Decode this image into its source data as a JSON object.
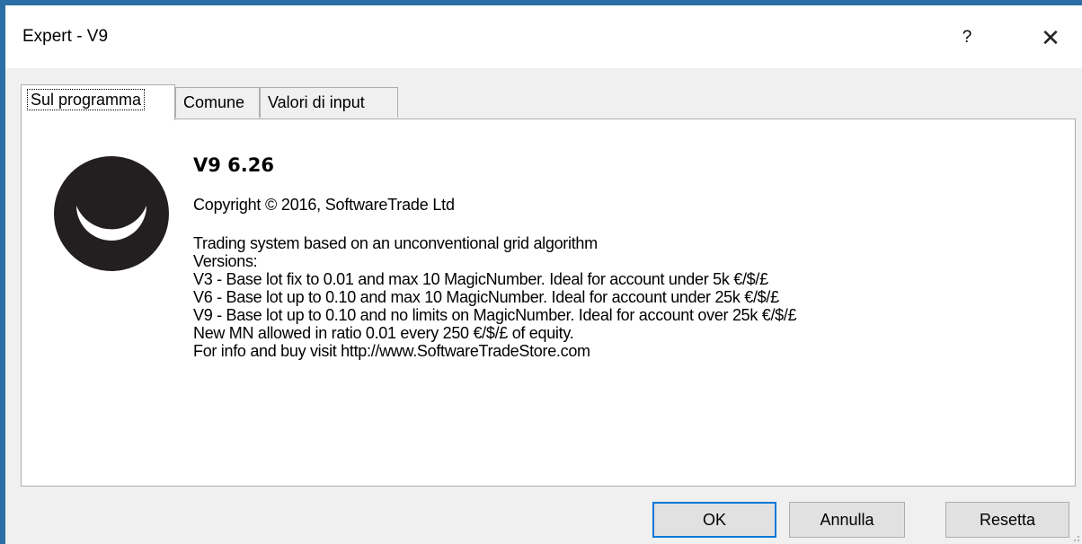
{
  "window": {
    "title": "Expert - V9",
    "help_label": "?",
    "close_label": "✕"
  },
  "tabs": [
    {
      "label": "Sul programma",
      "active": true
    },
    {
      "label": "Comune",
      "active": false
    },
    {
      "label": "Valori di input",
      "active": false
    }
  ],
  "about": {
    "logo_icon": "crescent-circle-logo-icon",
    "title": "V9 6.26",
    "copyright_symbol": "©",
    "copyright_text": "Copyright © 2016, SoftwareTrade Ltd",
    "description_lines": [
      "Trading system based on an unconventional grid algorithm",
      "Versions:",
      "V3 - Base lot fix to 0.01 and max 10 MagicNumber. Ideal for account under 5k €/$/£",
      "V6 - Base lot up to 0.10 and max 10 MagicNumber. Ideal for account under 25k €/$/£",
      "V9 - Base lot up to 0.10 and no limits on MagicNumber. Ideal for account over 25k €/$/£",
      "New MN allowed in ratio 0.01 every 250 €/$/£ of equity.",
      "For info and buy visit http://www.SoftwareTradeStore.com"
    ]
  },
  "buttons": {
    "ok": "OK",
    "cancel": "Annulla",
    "reset": "Resetta"
  },
  "colors": {
    "window_border": "#2c6fa6",
    "default_button_border": "#0078d7",
    "logo": "#231f20"
  }
}
